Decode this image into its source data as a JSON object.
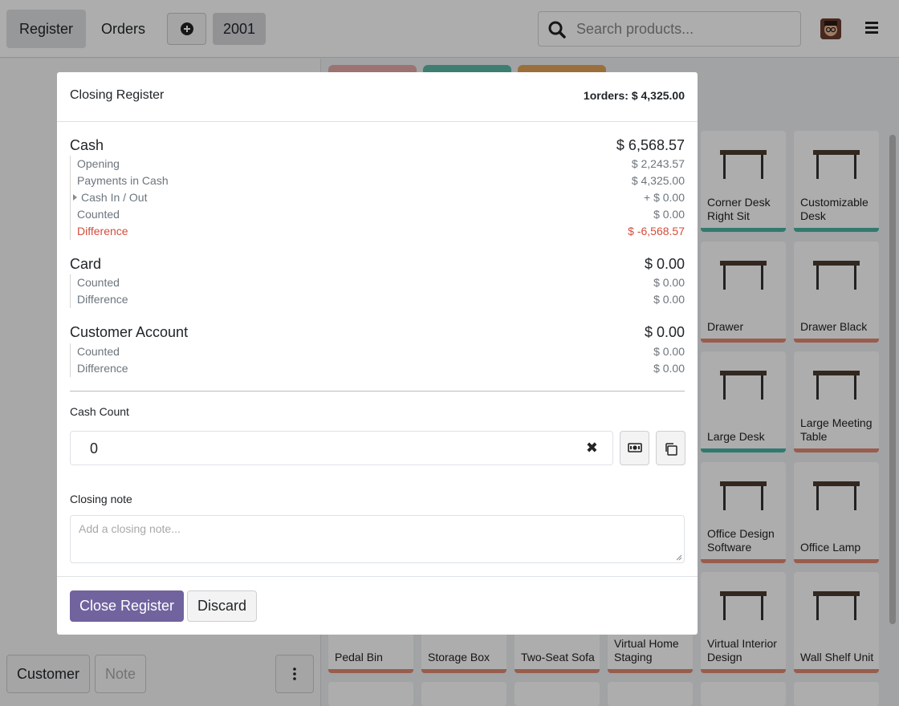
{
  "topbar": {
    "register_label": "Register",
    "orders_label": "Orders",
    "order_number": "2001",
    "search_placeholder": "Search products..."
  },
  "leftpane": {
    "customer_label": "Customer",
    "note_label": "Note"
  },
  "products": [
    {
      "name": "Corner Desk Right Sit",
      "stripe": "teal"
    },
    {
      "name": "Customizable Desk",
      "stripe": "teal"
    },
    {
      "name": "Drawer",
      "stripe": "salmon"
    },
    {
      "name": "Drawer Black",
      "stripe": "salmon"
    },
    {
      "name": "Large Desk",
      "stripe": "teal"
    },
    {
      "name": "Large Meeting Table",
      "stripe": "salmon"
    },
    {
      "name": "Office Design Software",
      "stripe": "salmon"
    },
    {
      "name": "Office Lamp",
      "stripe": "salmon"
    },
    {
      "name": "Pedal Bin",
      "stripe": "salmon"
    },
    {
      "name": "Storage Box",
      "stripe": "salmon"
    },
    {
      "name": "Two-Seat Sofa",
      "stripe": "salmon"
    },
    {
      "name": "Virtual Home Staging",
      "stripe": "salmon"
    },
    {
      "name": "Virtual Interior Design",
      "stripe": "salmon"
    },
    {
      "name": "Wall Shelf Unit",
      "stripe": "salmon"
    }
  ],
  "modal": {
    "title": "Closing Register",
    "orders_summary": "1orders: $ 4,325.00",
    "cash": {
      "title": "Cash",
      "total": "$ 6,568.57",
      "rows": [
        {
          "label": "Opening",
          "value": "$ 2,243.57"
        },
        {
          "label": "Payments in Cash",
          "value": "$ 4,325.00"
        },
        {
          "label": "Cash In / Out",
          "value": "+ $ 0.00"
        },
        {
          "label": "Counted",
          "value": "$ 0.00"
        },
        {
          "label": "Difference",
          "value": "$ -6,568.57"
        }
      ]
    },
    "card": {
      "title": "Card",
      "total": "$ 0.00",
      "rows": [
        {
          "label": "Counted",
          "value": "$ 0.00"
        },
        {
          "label": "Difference",
          "value": "$ 0.00"
        }
      ]
    },
    "customer_account": {
      "title": "Customer Account",
      "total": "$ 0.00",
      "rows": [
        {
          "label": "Counted",
          "value": "$ 0.00"
        },
        {
          "label": "Difference",
          "value": "$ 0.00"
        }
      ]
    },
    "cash_count_label": "Cash Count",
    "cash_count_value": "0",
    "closing_note_label": "Closing note",
    "closing_note_placeholder": "Add a closing note...",
    "close_button": "Close Register",
    "discard_button": "Discard"
  },
  "colors": {
    "primary": "#71639e",
    "danger": "#d44c3c",
    "teal": "#4ab3a4",
    "salmon": "#e08a72"
  }
}
